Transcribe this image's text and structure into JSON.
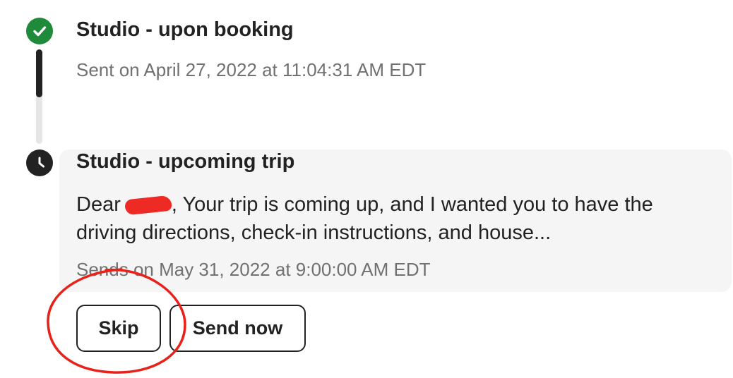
{
  "sent_message": {
    "title": "Studio - upon booking",
    "meta": "Sent on April 27, 2022 at 11:04:31 AM EDT",
    "status_icon": "check-icon"
  },
  "upcoming_message": {
    "title": "Studio - upcoming trip",
    "preview_before": "Dear",
    "preview_after": ", Your trip is coming up, and I wanted you to have the driving directions, check-in instructions, and house...",
    "meta": "Sends on May 31, 2022 at 9:00:00 AM EDT",
    "status_icon": "clock-icon"
  },
  "actions": {
    "skip_label": "Skip",
    "send_now_label": "Send now"
  },
  "colors": {
    "sent_status": "#1f8a3a",
    "scheduled_status": "#222222",
    "annotation": "#e8211b",
    "redaction": "#ee2a24",
    "card_background": "#f5f5f5",
    "meta_text": "#717171"
  }
}
